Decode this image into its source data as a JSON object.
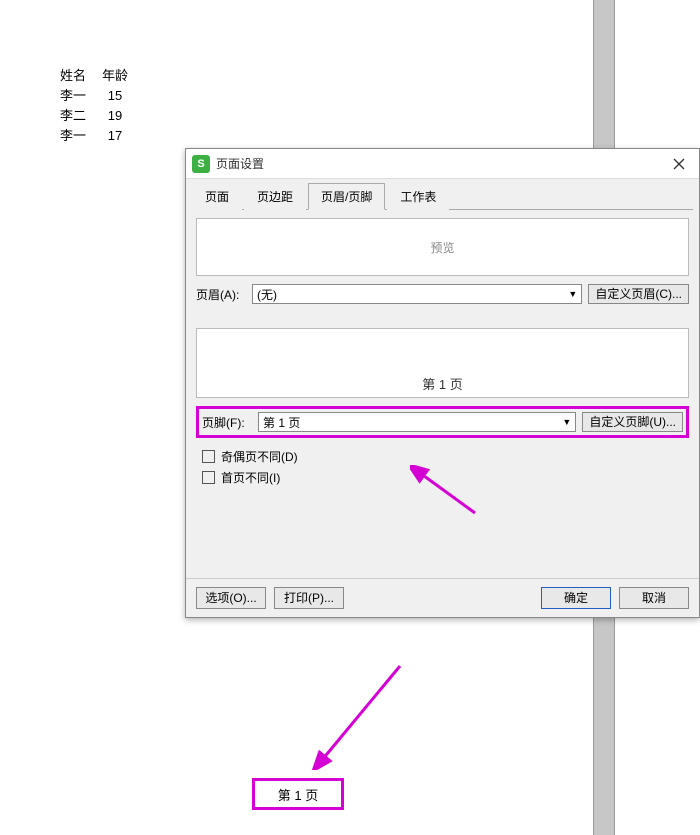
{
  "table": {
    "headers": [
      "姓名",
      "年龄"
    ],
    "rows": [
      [
        "李一",
        "15"
      ],
      [
        "李二",
        "19"
      ],
      [
        "李一",
        "17"
      ]
    ]
  },
  "dialog": {
    "title": "页面设置",
    "tabs": [
      "页面",
      "页边距",
      "页眉/页脚",
      "工作表"
    ],
    "active_tab": 2,
    "preview_label": "预览",
    "header_row": {
      "label": "页眉(A):",
      "value": "(无)",
      "custom_btn": "自定义页眉(C)..."
    },
    "footer_preview_text": "第 1 页",
    "footer_row": {
      "label": "页脚(F):",
      "value": "第 1 页",
      "custom_btn": "自定义页脚(U)..."
    },
    "checkboxes": [
      {
        "label": "奇偶页不同(D)",
        "checked": false
      },
      {
        "label": "首页不同(I)",
        "checked": false
      }
    ],
    "buttons": {
      "options": "选项(O)...",
      "print": "打印(P)...",
      "ok": "确定",
      "cancel": "取消"
    }
  },
  "page_footer": "第 1 页"
}
